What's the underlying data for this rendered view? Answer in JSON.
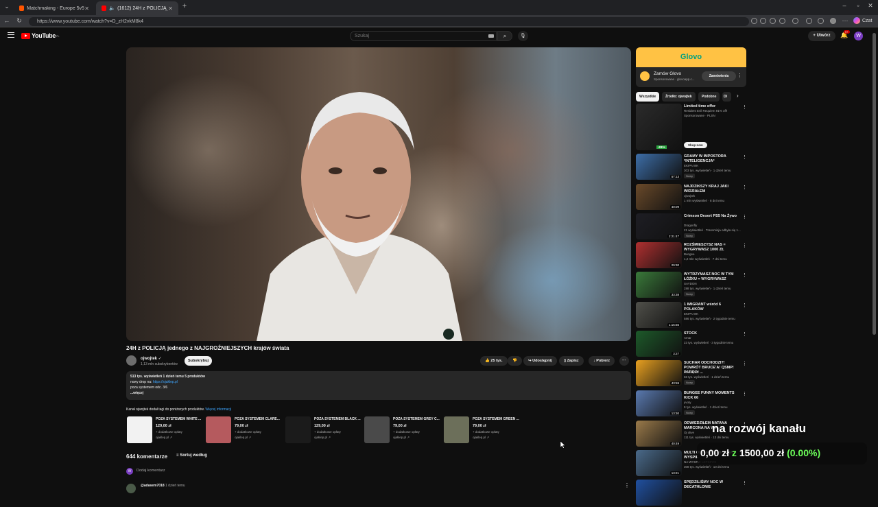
{
  "browser": {
    "tabs": [
      {
        "title": "Matchmaking - Europe 5v5 Queue",
        "active": false
      },
      {
        "title": "(1612) 24H z POLICJĄ jednego",
        "active": true
      }
    ],
    "url": "https://www.youtube.com/watch?v=D_zH2vkM8k4",
    "chat_label": "Czat"
  },
  "header": {
    "logo_text": "YouTube",
    "logo_region": "PL",
    "search_placeholder": "Szukaj",
    "create_label": "+ Utwórz",
    "notif_count": "9+",
    "avatar_letter": "W"
  },
  "video": {
    "title": "24H z POLICJĄ jednego z NAJGROŹNIEJSZYCH krajów świata",
    "channel": "ojwojtek",
    "subs": "1,13 mln subskrybentów",
    "subscribe_label": "Subskrybuj",
    "likes": "25 tys.",
    "share": "Udostępnij",
    "save": "Zapisz",
    "download": "Pobierz"
  },
  "description": {
    "stats": "513 tys. wyświetleń  1 dzień temu  5 produktów",
    "line2_prefix": "nowy drop na: ",
    "line2_link": "https://ojaklep.pl",
    "line3": "poza systemem odc. 3/6",
    "more": "...więcej"
  },
  "shop": {
    "info": "Kanał ojwojtek dodał tagi do poniższych produktów.",
    "info_link": "Więcej informacji",
    "products": [
      {
        "name": "POZA SYSTEMEM WHITE ...",
        "price": "129,00 zł",
        "fee": "+ dodatkowe opłaty",
        "store": "ojaklep.pl ↗",
        "color": "#f2f2f2"
      },
      {
        "name": "POZA SYSTEMEM CLARE...",
        "price": "79,00 zł",
        "fee": "+ dodatkowe opłaty",
        "store": "ojaklep.pl ↗",
        "color": "#b55a5e"
      },
      {
        "name": "POZA SYSTEMEM BLACK ...",
        "price": "129,00 zł",
        "fee": "+ dodatkowe opłaty",
        "store": "ojaklep.pl ↗",
        "color": "#1b1b1b"
      },
      {
        "name": "POZA SYSTEMEM GREY C...",
        "price": "79,00 zł",
        "fee": "+ dodatkowe opłaty",
        "store": "ojaklep.pl ↗",
        "color": "#4a4a4a"
      },
      {
        "name": "POZA SYSTEMEM GREEN ...",
        "price": "79,00 zł",
        "fee": "+ dodatkowe opłaty",
        "store": "ojaklep.pl ↗",
        "color": "#6c6f5a"
      }
    ]
  },
  "comments": {
    "count": "644 komentarze",
    "sort": "Sortuj według",
    "add": "Dodaj komentarz",
    "first_user": "@adasem7018",
    "first_time": "1 dzień temu"
  },
  "ad": {
    "brand": "Glovo",
    "title": "Zamów Glovo",
    "sub": "Sponsorowane · glovoapp.c...",
    "button": "Zamówienia"
  },
  "chips": [
    "Wszystkie",
    "Źródło: ojwojtek",
    "Podobne",
    "Dl"
  ],
  "recommendations": [
    {
      "title": "Limited time offer",
      "channel": "Resident Evil Requiem 91% off!",
      "meta": "Sponsorowane · PLSN",
      "badge": "",
      "duration": "",
      "thumb": "#2b2b2b",
      "extra": "Shop now",
      "price_tag": "-91%"
    },
    {
      "title": "GRAMY W IMPOSTORA *INTELIGENCJA*",
      "channel": "EKIPA WK",
      "meta": "303 tys. wyświetleń · 1 dzień temu",
      "badge": "Nowy",
      "duration": "57:13",
      "thumb": "#3d6ea8"
    },
    {
      "title": "NAJDZIKSZY KRAJ JAKI WIDZIAŁEM",
      "channel": "ojwojtek",
      "meta": "1 mln wyświetleń · 8 dni temu",
      "badge": "",
      "duration": "40:09",
      "thumb": "#6a4a2a"
    },
    {
      "title": "Crimson Desert PS5 Na Żywo",
      "channel": "Dragonfly",
      "meta": "21 wyświetleń · Transmisja odbyła się 1...",
      "badge": "Nowy",
      "duration": "2:21:47",
      "thumb": "#1e1e24"
    },
    {
      "title": "ROZŚMIESZYSZ NAS = WYGRYWASZ 1000 ZŁ",
      "channel": "Bungee",
      "meta": "1,2 mln wyświetleń · 7 dni temu",
      "badge": "",
      "duration": "29:30",
      "thumb": "#b03030"
    },
    {
      "title": "WYTRZYMASZ NOC W TYM ŁÓŻKU = WYGRYWASZ",
      "channel": "SAYDON",
      "meta": "288 tys. wyświetleń · 1 dzień temu",
      "badge": "Nowy",
      "duration": "33:38",
      "thumb": "#3a7a3a"
    },
    {
      "title": "1 IMIGRANT wśród 6 POLAKÓW",
      "channel": "EKIPA WK",
      "meta": "586 tys. wyświetleń · 2 tygodnie temu",
      "badge": "",
      "duration": "1:15:55",
      "thumb": "#50504a"
    },
    {
      "title": "STOCK",
      "channel": "Amar",
      "meta": "23 tys. wyświetleń · 3 tygodnie temu",
      "badge": "",
      "duration": "3:27",
      "thumb": "#1d5a2a"
    },
    {
      "title": "SUCHAR ODCHODZI?! POWRÓT BRUCE’A! QSMP! PATIRO! ...",
      "channel": "SzklanyYJ",
      "meta": "66 tys. wyświetleń · 1 dzień temu",
      "badge": "Nowy",
      "duration": "43:59",
      "thumb": "#e8a020"
    },
    {
      "title": "BUNGEE FUNNY MOMENTS KICK 66",
      "channel": "yvoty",
      "meta": "9 tys. wyświetleń · 1 dzień temu",
      "badge": "Nowy",
      "duration": "13:30",
      "thumb": "#5a7ab0"
    },
    {
      "title": "ODWIEDZIŁEM NATANA MARCONA NA WY...",
      "channel": "Oj olive",
      "meta": "111 tys. wyświetleń · 13 dni temu",
      "badge": "",
      "duration": "40:49",
      "thumb": "#9a7a4a"
    },
    {
      "title": "MULTI ODWIEDZIŁ NAS NA WYSPIE",
      "channel": "NA WYSPIE LEPSZYM",
      "meta": "308 tys. wyświetleń · 10 dni temu",
      "badge": "",
      "duration": "13:21",
      "thumb": "#4a6a8a"
    },
    {
      "title": "SPĘDZILIŚMY NOC W DECATHLONIE",
      "channel": "",
      "meta": "",
      "badge": "",
      "duration": "",
      "thumb": "#2050a0"
    }
  ],
  "overlay": {
    "goal_text": "na rozwój kanału",
    "amount": "0,00 zł",
    "of": "z",
    "target": "1500,00 zł",
    "percent": "(0.00%)"
  },
  "colors": {
    "bg": "#0f0f0f",
    "accent": "#ff0000",
    "link": "#3ea6ff",
    "glovo": "#ffc244",
    "overlay_green": "#6cff5a"
  }
}
